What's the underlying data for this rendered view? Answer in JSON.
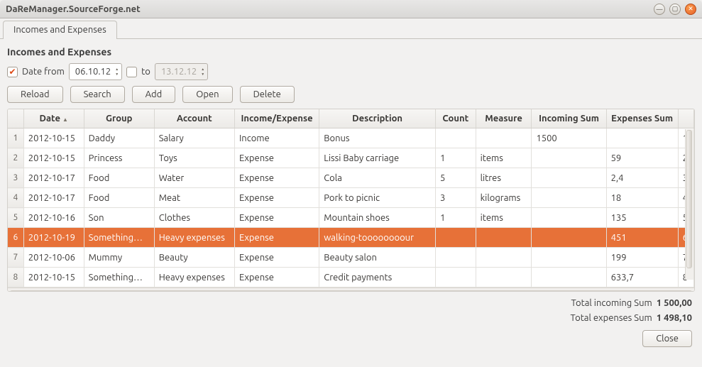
{
  "window": {
    "title": "DaReManager.SourceForge.net"
  },
  "tab": {
    "label": "Incomes and Expenses"
  },
  "section_title": "Incomes and Expenses",
  "filters": {
    "from_checked": true,
    "from_label": "Date from",
    "from_value": "06.10.12",
    "to_checked": false,
    "to_label": "to",
    "to_value": "13.12.12"
  },
  "toolbar": {
    "reload": "Reload",
    "search": "Search",
    "add": "Add",
    "open": "Open",
    "delete": "Delete"
  },
  "columns": [
    "Date",
    "Group",
    "Account",
    "Income/Expense",
    "Description",
    "Count",
    "Measure",
    "Incoming Sum",
    "Expenses Sum",
    ""
  ],
  "rows": [
    {
      "n": "1",
      "date": "2012-10-15",
      "group": "Daddy",
      "account": "Salary",
      "type": "Income",
      "desc": "Bonus",
      "count": "",
      "measure": "",
      "inc": "1500",
      "exp": "",
      "idx": "1",
      "selected": false
    },
    {
      "n": "2",
      "date": "2012-10-15",
      "group": "Princess",
      "account": "Toys",
      "type": "Expense",
      "desc": "Lissi Baby carriage",
      "count": "1",
      "measure": "items",
      "inc": "",
      "exp": "59",
      "idx": "2",
      "selected": false
    },
    {
      "n": "3",
      "date": "2012-10-17",
      "group": "Food",
      "account": "Water",
      "type": "Expense",
      "desc": "Cola",
      "count": "5",
      "measure": "litres",
      "inc": "",
      "exp": "2,4",
      "idx": "3",
      "selected": false
    },
    {
      "n": "4",
      "date": "2012-10-17",
      "group": "Food",
      "account": "Meat",
      "type": "Expense",
      "desc": "Pork to picnic",
      "count": "3",
      "measure": "kilograms",
      "inc": "",
      "exp": "18",
      "idx": "4",
      "selected": false
    },
    {
      "n": "5",
      "date": "2012-10-16",
      "group": "Son",
      "account": "Clothes",
      "type": "Expense",
      "desc": "Mountain shoes",
      "count": "1",
      "measure": "items",
      "inc": "",
      "exp": "135",
      "idx": "5",
      "selected": false
    },
    {
      "n": "6",
      "date": "2012-10-19",
      "group": "Something…",
      "account": "Heavy expenses",
      "type": "Expense",
      "desc": "walking-toooooooour",
      "count": "",
      "measure": "",
      "inc": "",
      "exp": "451",
      "idx": "6",
      "selected": true
    },
    {
      "n": "7",
      "date": "2012-10-06",
      "group": "Mummy",
      "account": "Beauty",
      "type": "Expense",
      "desc": "Beauty salon",
      "count": "",
      "measure": "",
      "inc": "",
      "exp": "199",
      "idx": "7",
      "selected": false
    },
    {
      "n": "8",
      "date": "2012-10-15",
      "group": "Something…",
      "account": "Heavy expenses",
      "type": "Expense",
      "desc": "Credit payments",
      "count": "",
      "measure": "",
      "inc": "",
      "exp": "633,7",
      "idx": "8",
      "selected": false
    }
  ],
  "totals": {
    "incoming_label": "Total incoming Sum",
    "incoming_value": "1 500,00",
    "expenses_label": "Total expenses Sum",
    "expenses_value": "1 498,10"
  },
  "close_btn": "Close"
}
